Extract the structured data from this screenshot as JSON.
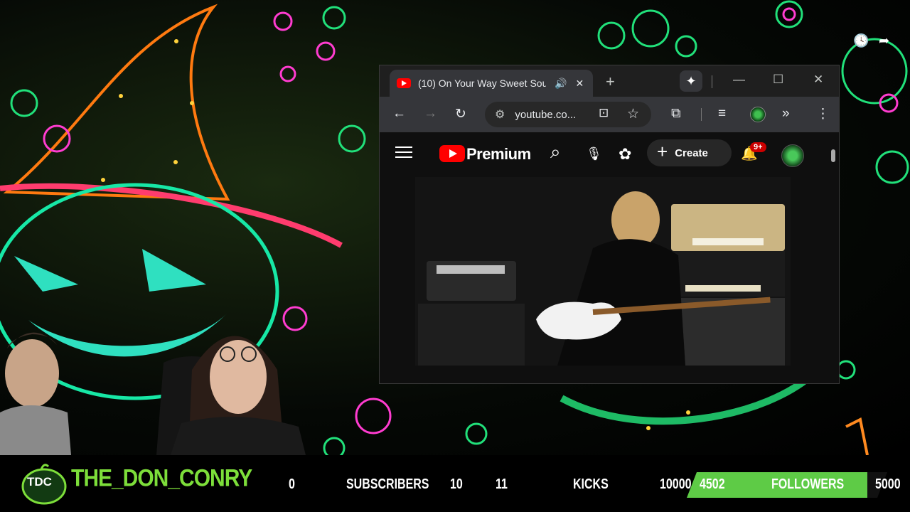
{
  "overlay": {
    "channel_name": "THE_DON_CONRY",
    "logo_text": "TDC",
    "subscribers": {
      "current": "0",
      "label": "SUBSCRIBERS",
      "goal": "10"
    },
    "kicks": {
      "current": "11",
      "label": "KICKS",
      "goal": "10000"
    },
    "followers": {
      "current": "4502",
      "label": "FOLLOWERS",
      "goal": "5000",
      "progress": 0.9
    },
    "accent_color": "#7dde3a"
  },
  "browser": {
    "tab_title": "(10) On Your Way Sweet Sou",
    "url": "youtube.co...",
    "icons": {
      "tab_audio": "🔊",
      "tab_close": "✕",
      "new_tab": "+",
      "gemini": "✦",
      "minimize": "—",
      "maximize": "☐",
      "close": "✕",
      "back": "←",
      "forward": "→",
      "reload": "↻",
      "site_info": "⚙",
      "install": "⊡",
      "bookmark": "☆",
      "extensions": "⧉",
      "media": "≡",
      "more_tools": "»",
      "menu": "⋮"
    }
  },
  "youtube": {
    "brand": "Premium",
    "create_label": "Create",
    "create_icon": "+",
    "notifications_badge": "9+",
    "icons": {
      "search": "⌕",
      "mic": "🎙",
      "ai": "✿",
      "bell": "🔔"
    }
  },
  "stream_icons": {
    "clock": "🕓",
    "share": "➦"
  }
}
